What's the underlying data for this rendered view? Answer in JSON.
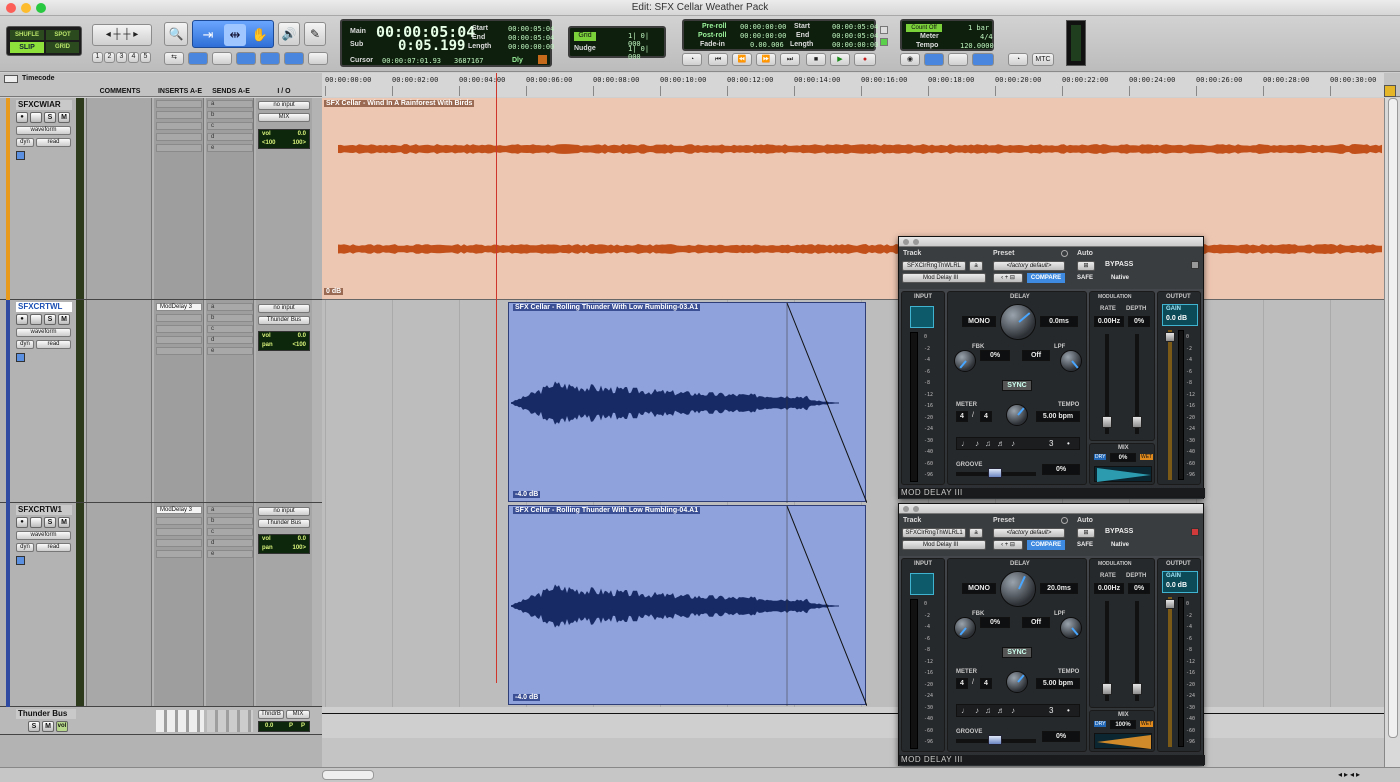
{
  "window": {
    "title": "Edit: SFX Cellar Weather Pack"
  },
  "toolbar": {
    "modes": {
      "shuffle": "SHUFLE",
      "spot": "SPOT",
      "slip": "SLIP",
      "grid": "GRID"
    },
    "zoom_presets": [
      "1",
      "2",
      "3",
      "4",
      "5"
    ],
    "counter": {
      "main_label": "Main",
      "main_value": "00:00:05:04",
      "sub_label": "Sub",
      "sub_value": "0:05.199",
      "start_label": "Start",
      "start_value": "00:00:05:04",
      "end_label": "End",
      "end_value": "00:00:05:04",
      "length_label": "Length",
      "length_value": "00:00:00:00",
      "cursor_label": "Cursor",
      "cursor_value": "00:00:07:01.93",
      "sample_value": "3687167",
      "dly_label": "Dly"
    },
    "grid": {
      "grid_label": "Grid",
      "grid_value": "1| 0| 000",
      "nudge_label": "Nudge",
      "nudge_value": "1| 0| 000"
    },
    "transport": {
      "preroll_label": "Pre-roll",
      "preroll_value": "00:00:00:00",
      "postroll_label": "Post-roll",
      "postroll_value": "00:00:00:00",
      "fadein_label": "Fade-in",
      "fadein_value": "0.00.006",
      "start_label": "Start",
      "start_value": "00:00:05:04",
      "end_label": "End",
      "end_value": "00:00:05:04",
      "length_label": "Length",
      "length_value": "00:00:00:00"
    },
    "midi": {
      "countoff_label": "Count Off",
      "countoff_value": "1 bar",
      "meter_label": "Meter",
      "meter_value": "4/4",
      "tempo_label": "Tempo",
      "tempo_value": "120.0000"
    },
    "mtc_label": "MTC"
  },
  "ruler": {
    "label": "Timecode",
    "ticks": [
      "00:00:00:00",
      "00:00:02:00",
      "00:00:04:00",
      "00:00:06:00",
      "00:00:08:00",
      "00:00:10:00",
      "00:00:12:00",
      "00:00:14:00",
      "00:00:16:00",
      "00:00:18:00",
      "00:00:20:00",
      "00:00:22:00",
      "00:00:24:00",
      "00:00:26:00",
      "00:00:28:00",
      "00:00:30:00"
    ]
  },
  "columns": {
    "comments": "COMMENTS",
    "inserts": "INSERTS A-E",
    "sends": "SENDS A-E",
    "io": "I / O"
  },
  "tracks": [
    {
      "name": "SFXCWIAR",
      "view": "waveform",
      "dyn": "dyn",
      "auto": "read",
      "insert": "",
      "input": "no input",
      "output": "MIX",
      "vol_label": "vol",
      "vol": "0.0",
      "pan_l": "<100",
      "pan_r": "100>",
      "clip": "SFX Cellar - Wind In A Rainforest With Birds",
      "gain": "0 dB"
    },
    {
      "name": "SFXCRTWL",
      "view": "waveform",
      "dyn": "dyn",
      "auto": "read",
      "insert": "ModDelay 3",
      "input": "no input",
      "output": "Thunder Bus",
      "vol_label": "vol",
      "vol": "0.0",
      "pan_label": "pan",
      "pan": "<100",
      "clip": "SFX Cellar - Rolling Thunder With Low Rumbling-03.A1",
      "gain": "-4.0 dB"
    },
    {
      "name": "SFXCRTW1",
      "view": "waveform",
      "dyn": "dyn",
      "auto": "read",
      "insert": "ModDelay 3",
      "input": "no input",
      "output": "Thunder Bus",
      "vol_label": "vol",
      "vol": "0.0",
      "pan_label": "pan",
      "pan": "100>",
      "clip": "SFX Cellar - Rolling Thunder With Low Rumbling-04.A1",
      "gain": "-4.0 dB"
    },
    {
      "name": "Thunder Bus",
      "input": "ThndrB",
      "output": "MIX",
      "vol": "0.0",
      "p1": "P",
      "p2": "P"
    }
  ],
  "send_letters": [
    "a",
    "b",
    "c",
    "d",
    "e"
  ],
  "plugins": [
    {
      "track_label": "Track",
      "track": "SFXClrRngThWLRL",
      "preset_label": "Preset",
      "preset": "<factory default>",
      "auto_label": "Auto",
      "plugin": "Mod Delay III",
      "compare": "COMPARE",
      "bypass": "BYPASS",
      "safe": "SAFE",
      "native": "Native",
      "input_label": "INPUT",
      "delay_label": "DELAY",
      "mod_label": "MODULATION",
      "output_label": "OUTPUT",
      "mono": "MONO",
      "delay": "0.0ms",
      "fbk_label": "FBK",
      "fbk": "0%",
      "lpf_label": "LPF",
      "lpf": "Off",
      "sync": "SYNC",
      "meter_label": "METER",
      "meter_n": "4",
      "meter_d": "4",
      "tempo_label": "TEMPO",
      "tempo": "5.00 bpm",
      "triplet": "3",
      "groove_label": "GROOVE",
      "groove": "0%",
      "rate_label": "RATE",
      "depth_label": "DEPTH",
      "rate": "0.00Hz",
      "depth": "0%",
      "mix_label": "MIX",
      "dry": "DRY",
      "mix": "0%",
      "wet": "WET",
      "gain_label": "GAIN",
      "gain": "0.0 dB",
      "footer": "MOD DELAY III",
      "mix_fill": 0.0
    },
    {
      "track_label": "Track",
      "track": "SFXClrRngThWLRL1",
      "preset_label": "Preset",
      "preset": "<factory default>",
      "auto_label": "Auto",
      "plugin": "Mod Delay III",
      "compare": "COMPARE",
      "bypass": "BYPASS",
      "safe": "SAFE",
      "native": "Native",
      "input_label": "INPUT",
      "delay_label": "DELAY",
      "mod_label": "MODULATION",
      "output_label": "OUTPUT",
      "mono": "MONO",
      "delay": "20.0ms",
      "fbk_label": "FBK",
      "fbk": "0%",
      "lpf_label": "LPF",
      "lpf": "Off",
      "sync": "SYNC",
      "meter_label": "METER",
      "meter_n": "4",
      "meter_d": "4",
      "tempo_label": "TEMPO",
      "tempo": "5.00 bpm",
      "triplet": "3",
      "groove_label": "GROOVE",
      "groove": "0%",
      "rate_label": "RATE",
      "depth_label": "DEPTH",
      "rate": "0.00Hz",
      "depth": "0%",
      "mix_label": "MIX",
      "dry": "DRY",
      "mix": "100%",
      "wet": "WET",
      "gain_label": "GAIN",
      "gain": "0.0 dB",
      "footer": "MOD DELAY III",
      "mix_fill": 1.0
    }
  ],
  "meter_scale": [
    "0",
    "-2",
    "-4",
    "-6",
    "-8",
    "-12",
    "-16",
    "-20",
    "-24",
    "-30",
    "-40",
    "-60",
    "-96"
  ],
  "colors": {
    "track1": "#e89a1d",
    "track2": "#2e4aa1",
    "clip1_bg": "#eec7b2",
    "clip1_wave": "#c1501a",
    "clip2_bg": "#8fa2db",
    "clip2_wave": "#172a66",
    "accent": "#3d8ae0"
  }
}
